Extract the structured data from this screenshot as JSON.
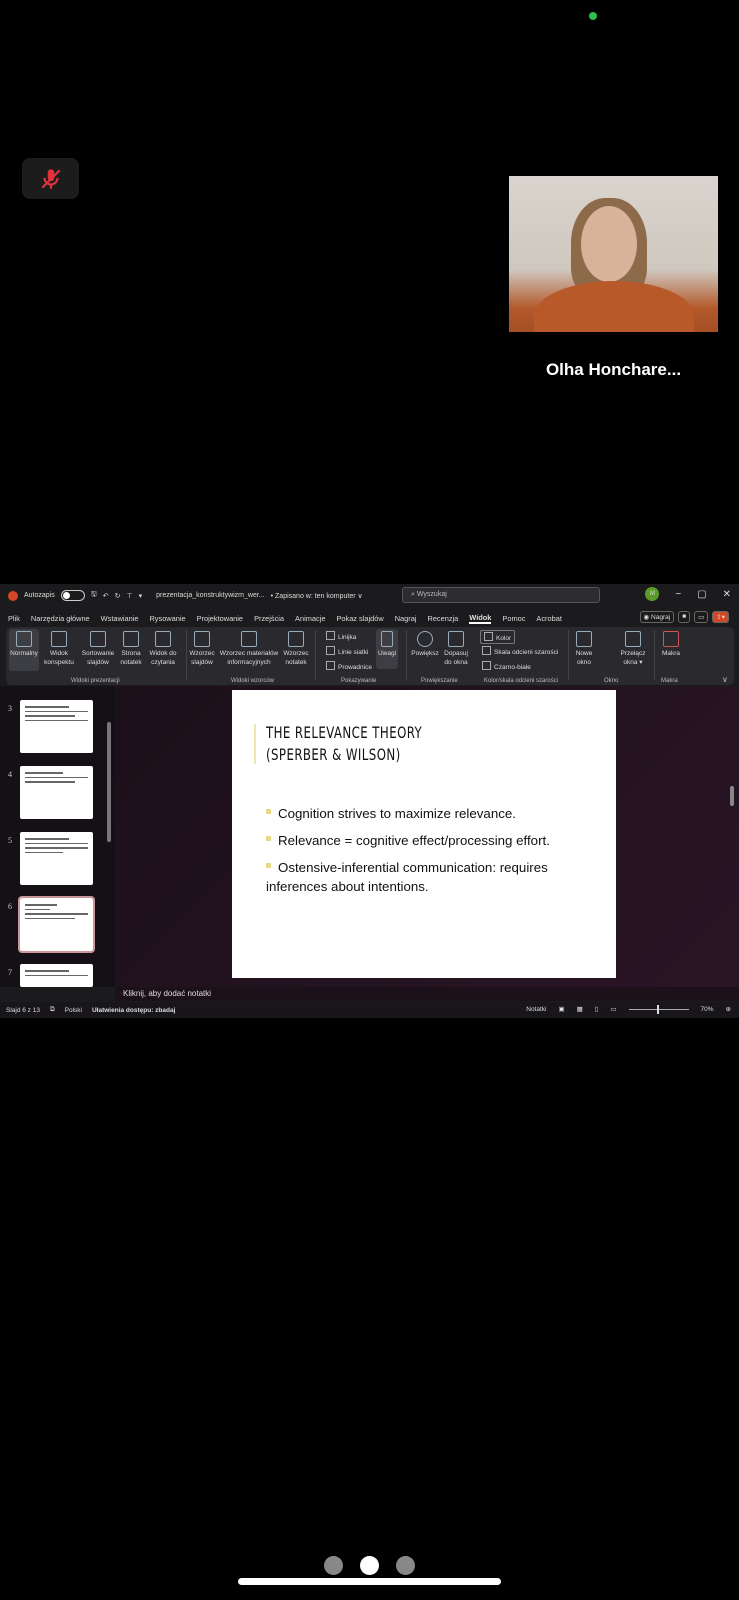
{
  "call": {
    "participant_name": "Olha Honchare...",
    "mic_state": "muted",
    "status_color": "#2fbf4a"
  },
  "ppt": {
    "titlebar": {
      "autosave_label": "Autozapis",
      "file_name": "prezentacja_konstruktywizm_wer...",
      "save_status": "• Zapisano w: ten komputer ∨",
      "search_placeholder": "Wyszukaj",
      "avatar_initial": "M",
      "minimize": "−",
      "restore": "▢",
      "close": "✕"
    },
    "tabs": [
      "Plik",
      "Narzędzia główne",
      "Wstawianie",
      "Rysowanie",
      "Projektowanie",
      "Przejścia",
      "Animacje",
      "Pokaz slajdów",
      "Nagraj",
      "Recenzja",
      "Widok",
      "Pomoc",
      "Acrobat"
    ],
    "active_tab": "Widok",
    "record_button": "◉ Nagraj",
    "ribbon": {
      "views": [
        "Normalny",
        "Widok konspektu",
        "Sortowanie slajdów",
        "Strona notatek",
        "Widok do czytania"
      ],
      "masters": [
        "Wzorzec slajdów",
        "Wzorzec materiałów informacyjnych",
        "Wzorzec notatek"
      ],
      "show": [
        "Linijka",
        "Linie siatki",
        "Prowadnice"
      ],
      "notes_btn": "Uwagi",
      "zoom": [
        "Powiększ",
        "Dopasuj do okna"
      ],
      "color": [
        "Kolor",
        "Skala odcieni szarości",
        "Czarno-białe"
      ],
      "window": [
        "Nowe okno",
        "Przełącz okna ▾"
      ],
      "macros": "Makra",
      "groups": [
        "Widoki prezentacji",
        "Widoki wzorców",
        "Pokazywanie",
        "Powiększanie",
        "Kolor/skala odcieni szarości",
        "Okno",
        "Makra"
      ]
    },
    "thumbnails": [
      {
        "num": "3"
      },
      {
        "num": "4"
      },
      {
        "num": "5"
      },
      {
        "num": "6",
        "selected": true
      },
      {
        "num": "7"
      }
    ],
    "slide": {
      "title_line1": "THE RELEVANCE THEORY",
      "title_line2": "(SPERBER & WILSON)",
      "bullets": [
        "Cognition strives to maximize relevance.",
        "Relevance = cognitive effect/processing effort.",
        "Ostensive-inferential communication: requires inferences about intentions."
      ]
    },
    "notes_placeholder": "Kliknij, aby dodać notatki",
    "status": {
      "slide_of": "Slajd 6 z 13",
      "language": "Polski",
      "accessibility": "Ułatwienia dostępu: zbadaj",
      "notes": "Notatki",
      "zoom": "70%"
    }
  }
}
